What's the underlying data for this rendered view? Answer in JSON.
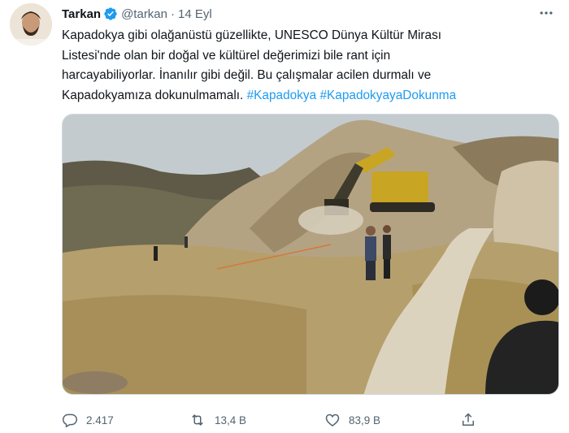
{
  "author": {
    "name": "Tarkan",
    "handle": "@tarkan",
    "separator": "·",
    "date": "14 Eyl"
  },
  "tweet_lines": [
    "Kapadokya gibi olağanüstü güzellikte, UNESCO Dünya Kültür Mirası",
    "Listesi'nde olan bir doğal ve kültürel değerimizi bile rant için",
    "harcayabiliyorlar. İnanılır gibi değil. Bu çalışmalar acilen durmalı ve",
    "Kapadokyamıza dokunulmamalı."
  ],
  "hashtags": [
    "#Kapadokya",
    "#KapadokyayaDokunma"
  ],
  "actions": {
    "replies": "2.417",
    "retweets": "13,4 B",
    "likes": "83,9 B"
  },
  "colors": {
    "accent": "#1d9bf0",
    "secondary_text": "#536471",
    "primary_text": "#0f1419"
  },
  "icons": {
    "verified": "verified-badge-icon",
    "more": "more-horizontal-icon",
    "reply": "reply-icon",
    "retweet": "retweet-icon",
    "like": "heart-icon",
    "share": "share-icon"
  }
}
